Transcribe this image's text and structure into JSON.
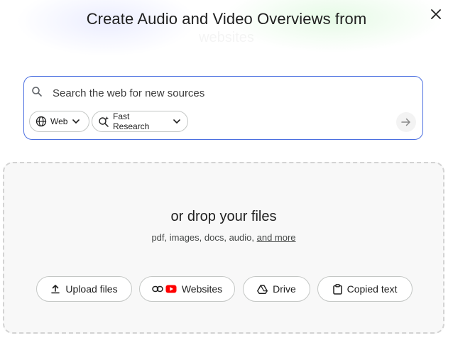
{
  "dialog": {
    "title": "Create Audio and Video Overviews from",
    "title_faded": "websites"
  },
  "search": {
    "placeholder": "Search the web for new sources",
    "value": "",
    "web_chip_label": "Web",
    "research_chip_label": "Fast Research"
  },
  "drop_zone": {
    "title": "or drop your files",
    "subtitle": "pdf, images, docs, audio,",
    "more_link": "and more"
  },
  "sources": [
    {
      "label": "Upload files",
      "icon": "upload-icon"
    },
    {
      "label": "Websites",
      "icon": "link-icon"
    },
    {
      "label": "Drive",
      "icon": "drive-icon"
    },
    {
      "label": "Copied text",
      "icon": "clipboard-icon"
    }
  ],
  "colors": {
    "accent_border": "#4b6fe0",
    "youtube_red": "#ff0000"
  }
}
